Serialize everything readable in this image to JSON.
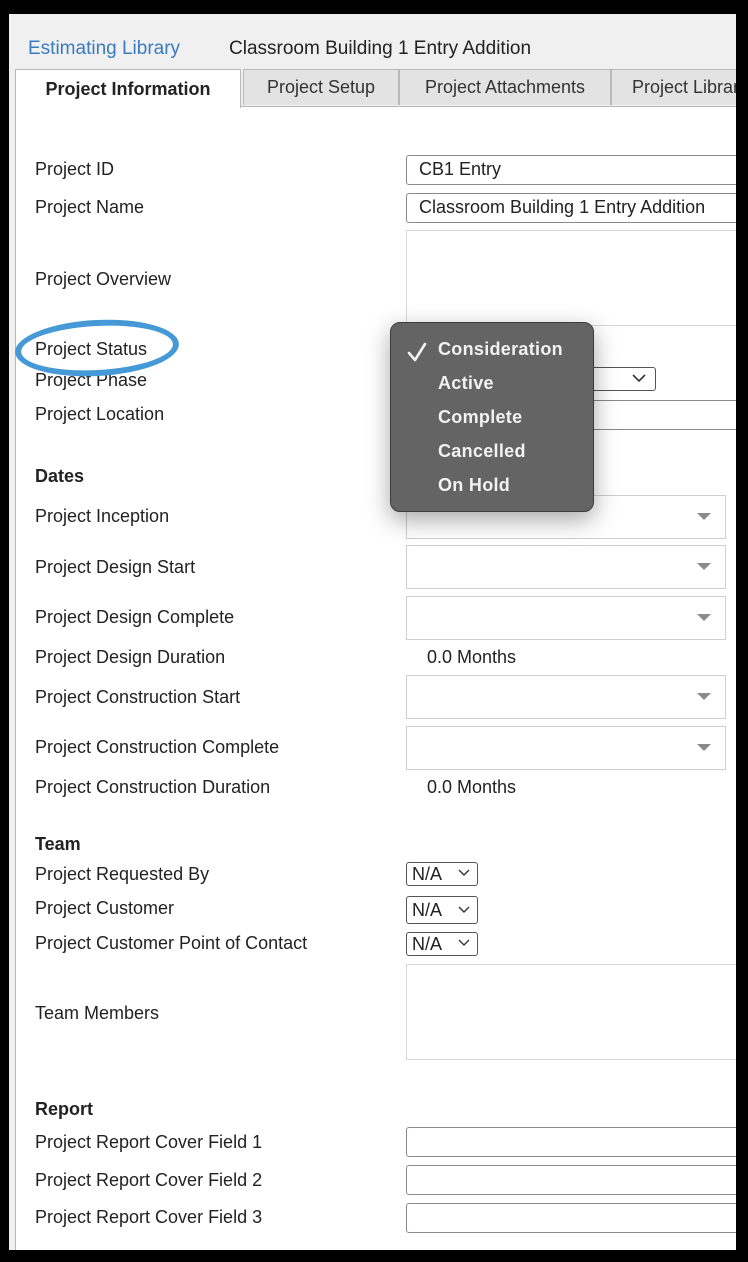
{
  "header": {
    "breadcrumb_link": "Estimating Library",
    "project_title": "Classroom Building 1 Entry Addition"
  },
  "tabs": [
    {
      "label": "Project Information",
      "active": true
    },
    {
      "label": "Project Setup",
      "active": false
    },
    {
      "label": "Project Attachments",
      "active": false
    },
    {
      "label": "Project Library",
      "active": false
    }
  ],
  "form": {
    "project_id": {
      "label": "Project ID",
      "value": "CB1 Entry"
    },
    "project_name": {
      "label": "Project Name",
      "value": "Classroom Building 1 Entry Addition"
    },
    "project_overview": {
      "label": "Project Overview",
      "value": ""
    },
    "project_status": {
      "label": "Project Status",
      "value": "Consideration"
    },
    "project_phase": {
      "label": "Project Phase",
      "value": ""
    },
    "project_location": {
      "label": "Project Location",
      "value": ""
    }
  },
  "dates": {
    "heading": "Dates",
    "inception": {
      "label": "Project Inception",
      "value": ""
    },
    "design_start": {
      "label": "Project Design Start",
      "value": ""
    },
    "design_complete": {
      "label": "Project Design Complete",
      "value": ""
    },
    "design_duration": {
      "label": "Project Design Duration",
      "value": "0.0 Months"
    },
    "construction_start": {
      "label": "Project Construction Start",
      "value": ""
    },
    "construction_complete": {
      "label": "Project Construction Complete",
      "value": ""
    },
    "construction_duration": {
      "label": "Project Construction Duration",
      "value": "0.0 Months"
    }
  },
  "team": {
    "heading": "Team",
    "requested_by": {
      "label": "Project Requested By",
      "value": "N/A"
    },
    "customer": {
      "label": "Project Customer",
      "value": "N/A"
    },
    "customer_poc": {
      "label": "Project Customer Point of Contact",
      "value": "N/A"
    },
    "members": {
      "label": "Team Members",
      "value": ""
    }
  },
  "report": {
    "heading": "Report",
    "cover_field_1": {
      "label": "Project Report Cover Field 1",
      "value": ""
    },
    "cover_field_2": {
      "label": "Project Report Cover Field 2",
      "value": ""
    },
    "cover_field_3": {
      "label": "Project Report Cover Field 3",
      "value": ""
    }
  },
  "status_menu": {
    "selected": "Consideration",
    "options": [
      "Consideration",
      "Active",
      "Complete",
      "Cancelled",
      "On Hold"
    ]
  },
  "colors": {
    "link": "#3a7bbf",
    "annotation_circle": "#4599d6",
    "menu_bg": "#646464"
  }
}
